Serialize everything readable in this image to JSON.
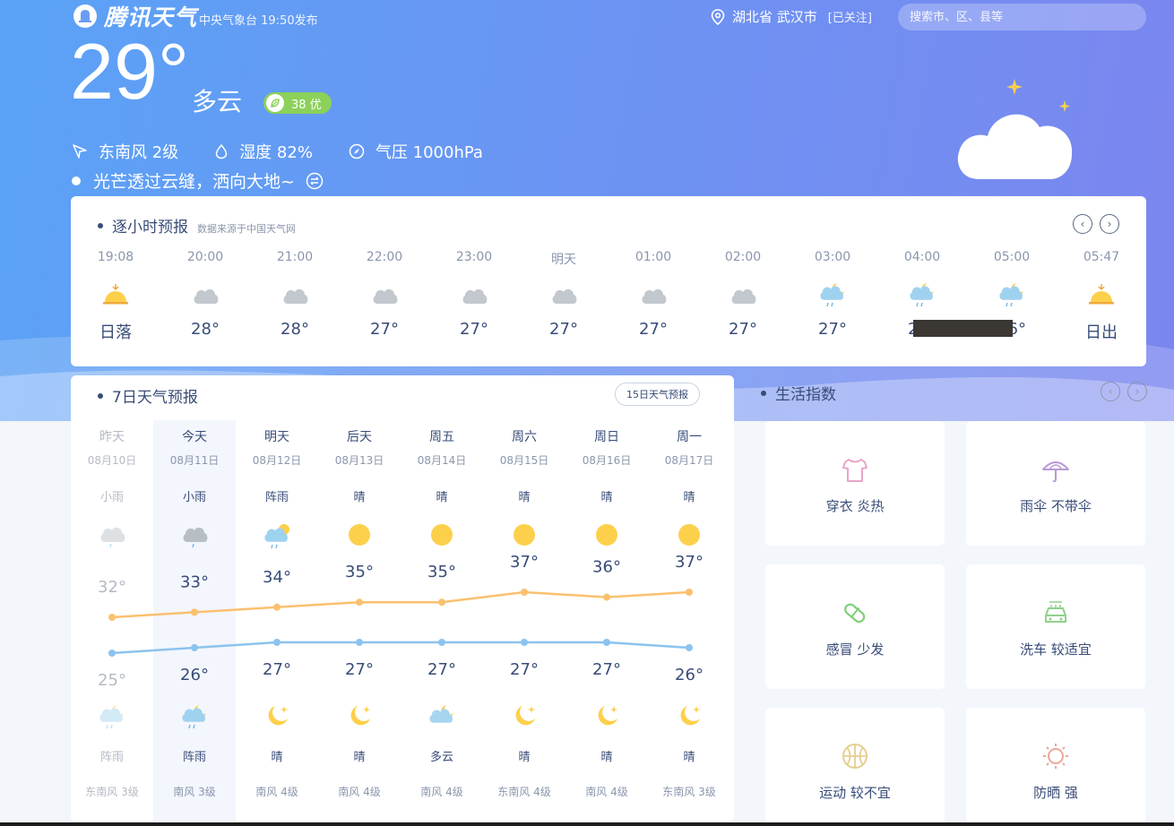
{
  "brand": {
    "name": "腾讯天气",
    "publish": "中央气象台 19:50发布"
  },
  "location": {
    "name": "湖北省 武汉市",
    "follow": "[已关注]"
  },
  "search": {
    "placeholder": "搜索市、区、县等"
  },
  "current": {
    "temp": "29°",
    "condition": "多云",
    "aqi": "38 优",
    "wind": "东南风 2级",
    "humidity": "湿度 82%",
    "pressure": "气压 1000hPa",
    "tip": "光芒透过云缝，洒向大地~"
  },
  "hourly": {
    "title": "逐小时预报",
    "source": "数据来源于中国天气网",
    "items": [
      {
        "time": "19:08",
        "icon": "sunset-icon",
        "temp": "日落"
      },
      {
        "time": "20:00",
        "icon": "cloudy-icon",
        "temp": "28°"
      },
      {
        "time": "21:00",
        "icon": "cloudy-icon",
        "temp": "28°"
      },
      {
        "time": "22:00",
        "icon": "cloudy-icon",
        "temp": "27°"
      },
      {
        "time": "23:00",
        "icon": "cloudy-icon",
        "temp": "27°"
      },
      {
        "time": "明天",
        "icon": "cloudy-icon",
        "temp": "27°"
      },
      {
        "time": "01:00",
        "icon": "cloudy-icon",
        "temp": "27°"
      },
      {
        "time": "02:00",
        "icon": "cloudy-icon",
        "temp": "27°"
      },
      {
        "time": "03:00",
        "icon": "night-shower-icon",
        "temp": "27°"
      },
      {
        "time": "04:00",
        "icon": "night-shower-icon",
        "temp": "26°"
      },
      {
        "time": "05:00",
        "icon": "night-shower-icon",
        "temp": "26°"
      },
      {
        "time": "05:47",
        "icon": "sunrise-icon",
        "temp": "日出"
      }
    ]
  },
  "week": {
    "title": "7日天气预报",
    "more_button": "15日天气预报",
    "days": [
      {
        "name": "昨天",
        "date": "08月10日",
        "day_weather": "小雨",
        "day_icon": "light-rain-icon",
        "high": "32°",
        "low": "25°",
        "night_icon": "night-shower-icon",
        "night_weather": "阵雨",
        "wind": "东南风 3级"
      },
      {
        "name": "今天",
        "date": "08月11日",
        "day_weather": "小雨",
        "day_icon": "light-rain-icon",
        "high": "33°",
        "low": "26°",
        "night_icon": "night-shower-icon",
        "night_weather": "阵雨",
        "wind": "南风 3级"
      },
      {
        "name": "明天",
        "date": "08月12日",
        "day_weather": "阵雨",
        "day_icon": "shower-icon",
        "high": "34°",
        "low": "27°",
        "night_icon": "moon-icon",
        "night_weather": "晴",
        "wind": "南风 4级"
      },
      {
        "name": "后天",
        "date": "08月13日",
        "day_weather": "晴",
        "day_icon": "sun-icon",
        "high": "35°",
        "low": "27°",
        "night_icon": "moon-icon",
        "night_weather": "晴",
        "wind": "南风 4级"
      },
      {
        "name": "周五",
        "date": "08月14日",
        "day_weather": "晴",
        "day_icon": "sun-icon",
        "high": "35°",
        "low": "27°",
        "night_icon": "night-cloudy-icon",
        "night_weather": "多云",
        "wind": "南风 4级"
      },
      {
        "name": "周六",
        "date": "08月15日",
        "day_weather": "晴",
        "day_icon": "sun-icon",
        "high": "37°",
        "low": "27°",
        "night_icon": "moon-icon",
        "night_weather": "晴",
        "wind": "东南风 4级"
      },
      {
        "name": "周日",
        "date": "08月16日",
        "day_weather": "晴",
        "day_icon": "sun-icon",
        "high": "36°",
        "low": "27°",
        "night_icon": "moon-icon",
        "night_weather": "晴",
        "wind": "南风 4级"
      },
      {
        "name": "周一",
        "date": "08月17日",
        "day_weather": "晴",
        "day_icon": "sun-icon",
        "high": "37°",
        "low": "26°",
        "night_icon": "moon-icon",
        "night_weather": "晴",
        "wind": "东南风 3级"
      }
    ],
    "high_values": [
      32,
      33,
      34,
      35,
      35,
      37,
      36,
      37
    ],
    "low_values": [
      25,
      26,
      27,
      27,
      27,
      27,
      27,
      26
    ]
  },
  "life": {
    "title": "生活指数",
    "items": [
      {
        "label": "穿衣 炎热",
        "icon": "tshirt-icon",
        "color": "#e8a5c8"
      },
      {
        "label": "雨伞 不带伞",
        "icon": "umbrella-icon",
        "color": "#b79ad6"
      },
      {
        "label": "感冒 少发",
        "icon": "pill-icon",
        "color": "#7fcf7a"
      },
      {
        "label": "洗车 较适宜",
        "icon": "car-icon",
        "color": "#8fd18a"
      },
      {
        "label": "运动 较不宜",
        "icon": "basketball-icon",
        "color": "#e6cf8f"
      },
      {
        "label": "防晒 强",
        "icon": "sun-outline-icon",
        "color": "#e9a99a"
      }
    ]
  },
  "colors": {
    "high_line": "#fbc06f",
    "low_line": "#8cc3ee",
    "sun": "#fdd04c"
  }
}
